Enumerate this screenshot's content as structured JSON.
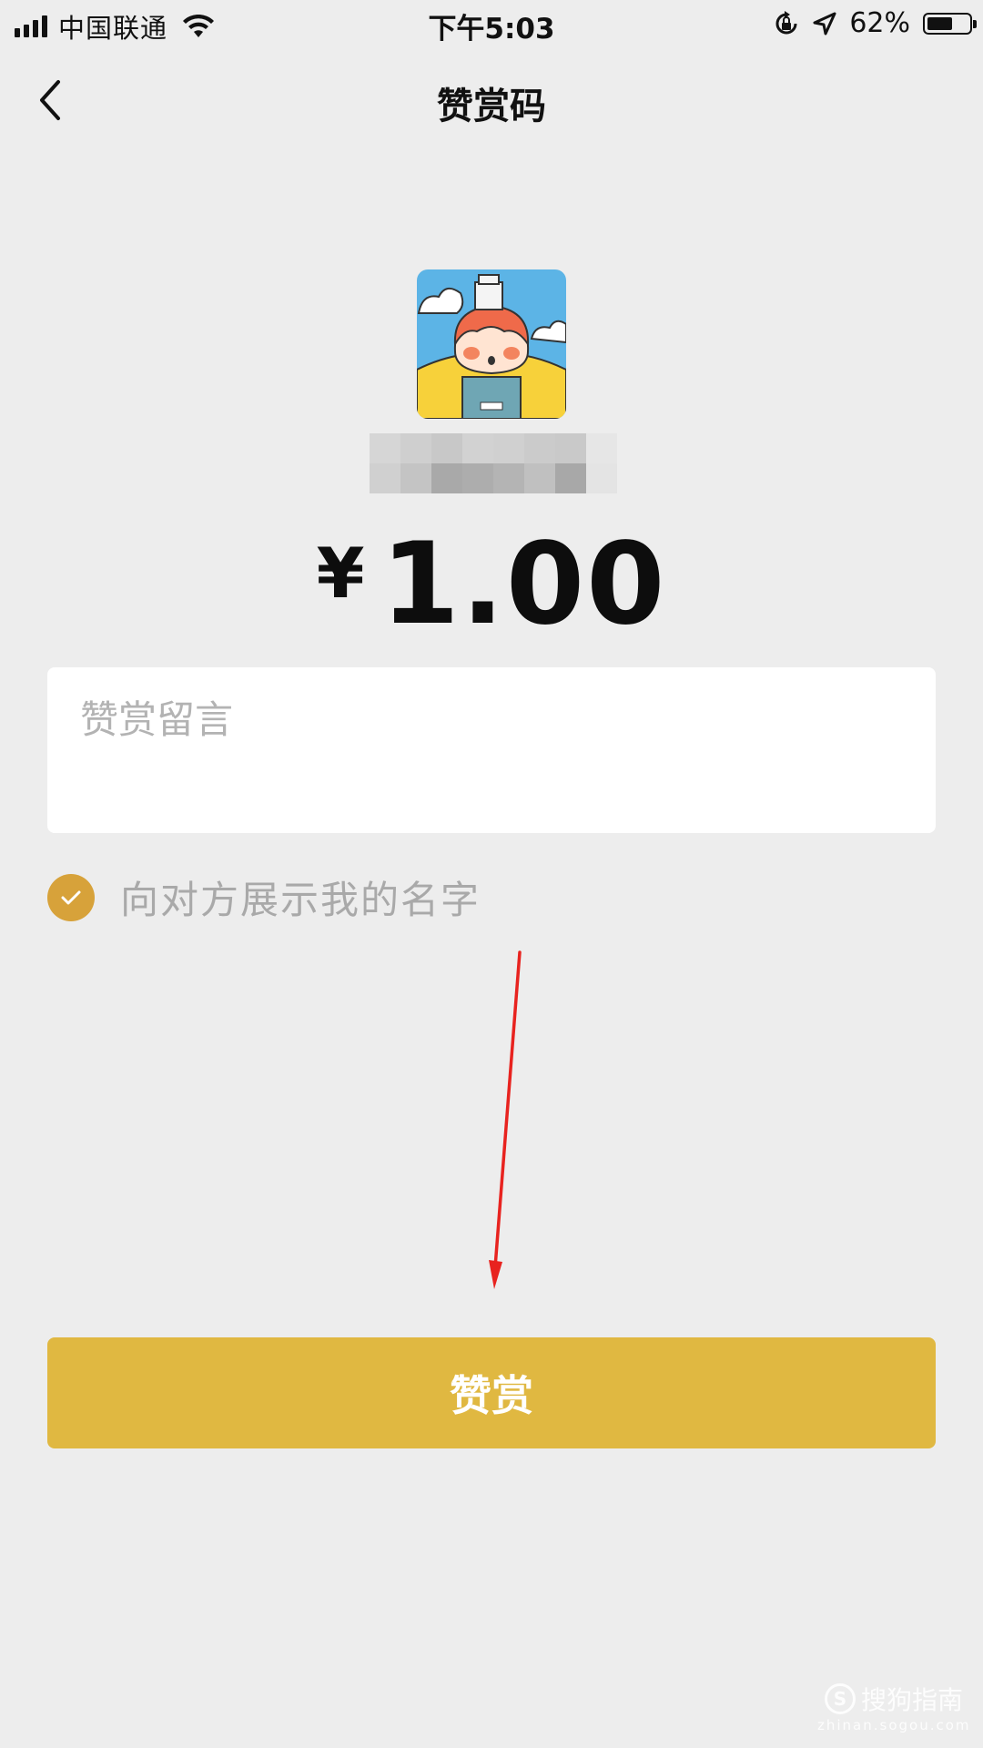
{
  "status_bar": {
    "carrier": "中国联通",
    "time": "下午5:03",
    "battery_percent": "62%",
    "battery_level": 0.62,
    "icons": [
      "signal-icon",
      "wifi-icon",
      "rotation-lock-icon",
      "location-icon",
      "battery-icon"
    ]
  },
  "nav": {
    "title": "赞赏码",
    "back_icon": "chevron-left-icon"
  },
  "amount": {
    "currency": "¥",
    "value": "1.00"
  },
  "message": {
    "placeholder": "赞赏留言"
  },
  "show_name": {
    "label": "向对方展示我的名字",
    "checked": true,
    "accent_color": "#d7a23a"
  },
  "reward_button": {
    "label": "赞赏",
    "color": "#e0b841"
  },
  "watermark": {
    "brand": "搜狗指南",
    "url": "zhinan.sogou.com"
  }
}
